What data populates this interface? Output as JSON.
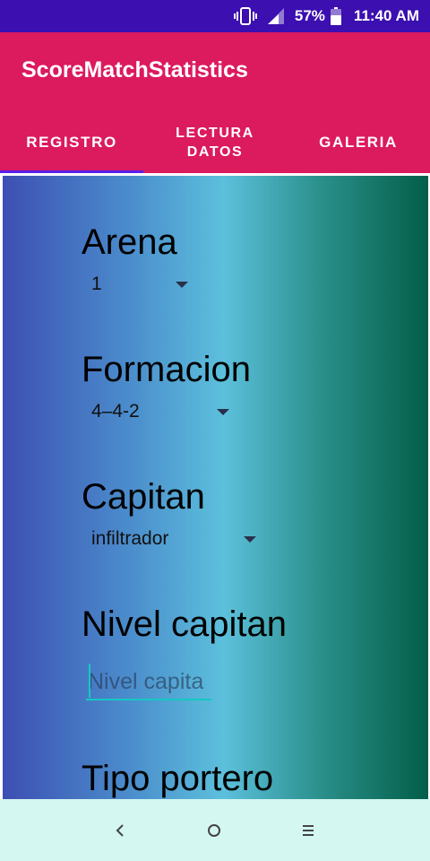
{
  "status_bar": {
    "battery": "57%",
    "time": "11:40 AM",
    "icons": [
      "vibrate-icon",
      "signal-icon",
      "battery-icon"
    ]
  },
  "app": {
    "title": "ScoreMatchStatistics"
  },
  "tabs": [
    {
      "label": "REGISTRO",
      "selected": true
    },
    {
      "label": "LECTURA DATOS",
      "selected": false
    },
    {
      "label": "GALERIA",
      "selected": false
    }
  ],
  "form": {
    "arena": {
      "label": "Arena",
      "value": "1"
    },
    "formacion": {
      "label": "Formacion",
      "value": "4–4-2"
    },
    "capitan": {
      "label": "Capitan",
      "value": "infiltrador"
    },
    "nivel_capitan": {
      "label": "Nivel capitan",
      "placeholder": "Nivel capita"
    },
    "tipo_portero": {
      "label": "Tipo portero"
    }
  },
  "nav_bar": {
    "icons": [
      "back-icon",
      "home-icon",
      "menu-icon"
    ]
  },
  "colors": {
    "status_bar": "#3b0fb0",
    "app_bar": "#dc1a5e",
    "tab_indicator": "#5b1ee8",
    "input_underline": "#14c9c2",
    "nav_bar": "#d4f7f1"
  }
}
